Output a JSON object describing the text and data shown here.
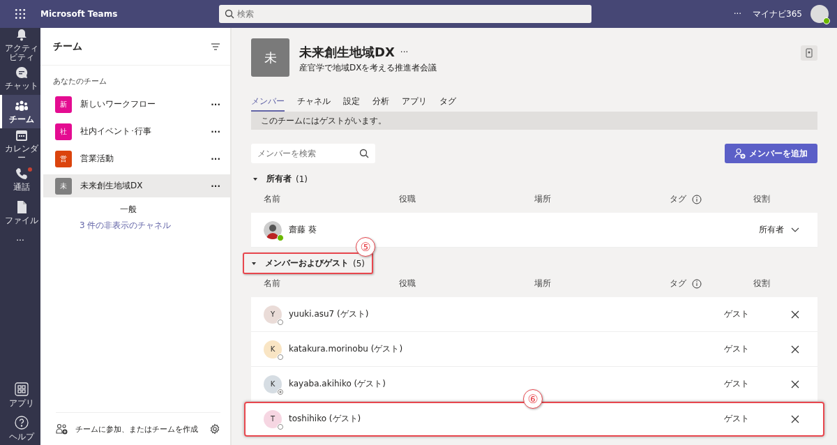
{
  "app_bar": {
    "title": "Microsoft Teams",
    "search": {
      "placeholder": "検索"
    },
    "more": "···",
    "org": "マイナビ365"
  },
  "rail": [
    {
      "label": "アクティビティ",
      "kind": "bell",
      "selected": false,
      "badge": false
    },
    {
      "label": "チャット",
      "kind": "chat",
      "selected": false,
      "badge": false
    },
    {
      "label": "チーム",
      "kind": "teams",
      "selected": true,
      "badge": false
    },
    {
      "label": "カレンダー",
      "kind": "calendar",
      "selected": false,
      "badge": false
    },
    {
      "label": "通話",
      "kind": "phone",
      "selected": false,
      "badge": true
    },
    {
      "label": "ファイル",
      "kind": "file",
      "selected": false,
      "badge": false
    }
  ],
  "rail_more": "···",
  "rail_bottom": [
    {
      "label": "アプリ",
      "kind": "apps"
    },
    {
      "label": "ヘルプ",
      "kind": "help"
    }
  ],
  "teams_panel": {
    "title": "チーム",
    "section": "あなたのチーム",
    "teams": [
      {
        "initial": "新",
        "name": "新しいワークフロー",
        "color": "#e3008c",
        "selected": false,
        "more": "···"
      },
      {
        "initial": "社",
        "name": "社内イベント･行事",
        "color": "#e3008c",
        "selected": false,
        "more": "···"
      },
      {
        "initial": "営",
        "name": "営業活動",
        "color": "#da3b01",
        "selected": false,
        "more": "···"
      },
      {
        "initial": "未",
        "name": "未来創生地域DX",
        "color": "#7a7a7a",
        "selected": true,
        "more": "···",
        "channels": [
          "一般"
        ],
        "hidden_link": "3 件の非表示のチャネル"
      }
    ],
    "footer": "チームに参加、またはチームを作成"
  },
  "team": {
    "initial": "未",
    "name": "未来創生地域DX",
    "more": "···",
    "description": "産官学で地域DXを考える推進者会議"
  },
  "tabs": [
    {
      "label": "メンバー",
      "selected": true
    },
    {
      "label": "チャネル",
      "selected": false
    },
    {
      "label": "設定",
      "selected": false
    },
    {
      "label": "分析",
      "selected": false
    },
    {
      "label": "アプリ",
      "selected": false
    },
    {
      "label": "タグ",
      "selected": false
    }
  ],
  "notice": "このチームにはゲストがいます。",
  "member_search": {
    "placeholder": "メンバーを検索"
  },
  "add_button": "メンバーを追加",
  "sections": [
    {
      "title": "所有者",
      "count": "(1)",
      "expanded": true,
      "highlighted": false,
      "columns": [
        "名前",
        "役職",
        "場所",
        "タグ",
        "役割"
      ],
      "members": [
        {
          "name": "齋藤 葵",
          "photo": true,
          "presence": {
            "kind": "available"
          },
          "role": "所有者",
          "role_dropdown": true,
          "removable": false,
          "color": "#cccccc",
          "highlighted": false
        }
      ]
    },
    {
      "title": "メンバーおよびゲスト",
      "count": "(5)",
      "expanded": true,
      "highlighted": true,
      "callout": "⑤",
      "columns": [
        "名前",
        "役職",
        "場所",
        "タグ",
        "役割"
      ],
      "members": [
        {
          "initial": "Y",
          "name": "yuuki.asu7 (ゲスト)",
          "photo": false,
          "presence": {
            "kind": "offline"
          },
          "role": "ゲスト",
          "role_dropdown": false,
          "removable": true,
          "color": "#eadcd8",
          "highlighted": false
        },
        {
          "initial": "K",
          "name": "katakura.morinobu (ゲスト)",
          "photo": false,
          "presence": {
            "kind": "offline"
          },
          "role": "ゲスト",
          "role_dropdown": false,
          "removable": true,
          "color": "#f9e5c4",
          "highlighted": false
        },
        {
          "initial": "K",
          "name": "kayaba.akihiko (ゲスト)",
          "photo": false,
          "presence": {
            "kind": "blocked"
          },
          "role": "ゲスト",
          "role_dropdown": false,
          "removable": true,
          "color": "#d6dde3",
          "highlighted": false
        },
        {
          "initial": "T",
          "name": "toshihiko (ゲスト)",
          "photo": false,
          "presence": {
            "kind": "offline"
          },
          "role": "ゲスト",
          "role_dropdown": false,
          "removable": true,
          "color": "#f6d6e2",
          "highlighted": true,
          "callout": "⑥"
        }
      ]
    }
  ]
}
